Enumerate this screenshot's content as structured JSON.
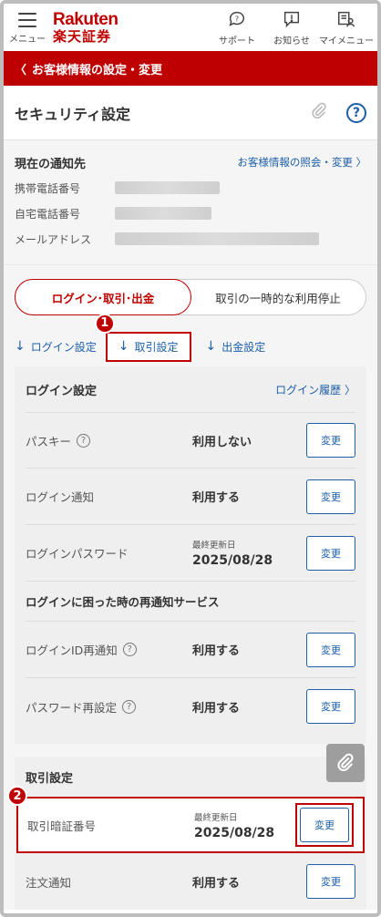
{
  "header": {
    "menu_label": "メニュー",
    "logo_top": "Rakuten",
    "logo_bottom": "楽天証券",
    "support_label": "サポート",
    "notice_label": "お知らせ",
    "mymenu_label": "マイメニュー"
  },
  "breadcrumb": {
    "back_label": "お客様情報の設定・変更"
  },
  "page": {
    "title": "セキュリティ設定"
  },
  "notify": {
    "title": "現在の通知先",
    "link": "お客様情報の照会・変更",
    "rows": [
      {
        "label": "携帯電話番号"
      },
      {
        "label": "自宅電話番号"
      },
      {
        "label": "メールアドレス"
      }
    ]
  },
  "tabs": {
    "active": "ログイン･取引･出金",
    "other": "取引の一時的な利用停止"
  },
  "anchors": {
    "login": "ログイン設定",
    "trade": "取引設定",
    "withdraw": "出金設定",
    "badge1": "1",
    "badge2": "2"
  },
  "login_card": {
    "title": "ログイン設定",
    "history_link": "ログイン履歴",
    "rows": [
      {
        "label": "パスキー",
        "value": "利用しない",
        "button": "変更"
      },
      {
        "label": "ログイン通知",
        "value": "利用する",
        "button": "変更"
      },
      {
        "label": "ログインパスワード",
        "sub": "最終更新日",
        "value": "2025/08/28",
        "button": "変更"
      }
    ],
    "recovery_title": "ログインに困った時の再通知サービス",
    "recovery_rows": [
      {
        "label": "ログインID再通知",
        "value": "利用する",
        "button": "変更"
      },
      {
        "label": "パスワード再設定",
        "value": "利用する",
        "button": "変更"
      }
    ]
  },
  "trade_card": {
    "title": "取引設定",
    "rows": [
      {
        "label": "取引暗証番号",
        "sub": "最終更新日",
        "value": "2025/08/28",
        "button": "変更"
      },
      {
        "label": "注文通知",
        "value": "利用する",
        "button": "変更"
      }
    ]
  },
  "colors": {
    "brand": "#bf0000",
    "link": "#1d5fa8"
  }
}
